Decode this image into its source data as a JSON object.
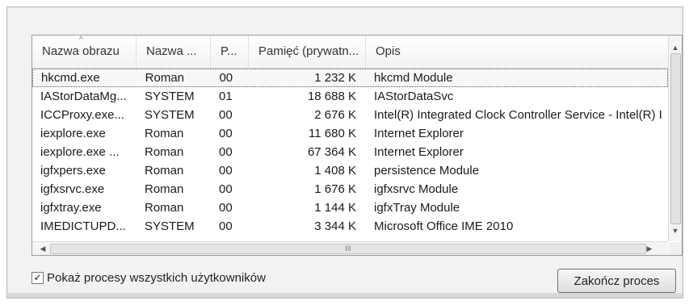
{
  "columns": [
    "Nazwa obrazu",
    "Nazwa ...",
    "P...",
    "Pamięć (prywatn...",
    "Opis"
  ],
  "rows": [
    {
      "name": "hkcmd.exe",
      "user": "Roman",
      "cpu": "00",
      "mem": "1 232 K",
      "desc": "hkcmd Module",
      "selected": true
    },
    {
      "name": "IAStorDataMg...",
      "user": "SYSTEM",
      "cpu": "01",
      "mem": "18 688 K",
      "desc": "IAStorDataSvc"
    },
    {
      "name": "ICCProxy.exe...",
      "user": "SYSTEM",
      "cpu": "00",
      "mem": "2 676 K",
      "desc": "Intel(R) Integrated Clock Controller Service - Intel(R) I"
    },
    {
      "name": "iexplore.exe",
      "user": "Roman",
      "cpu": "00",
      "mem": "11 680 K",
      "desc": "Internet Explorer"
    },
    {
      "name": "iexplore.exe ...",
      "user": "Roman",
      "cpu": "00",
      "mem": "67 364 K",
      "desc": "Internet Explorer"
    },
    {
      "name": "igfxpers.exe",
      "user": "Roman",
      "cpu": "00",
      "mem": "1 408 K",
      "desc": "persistence Module"
    },
    {
      "name": "igfxsrvc.exe",
      "user": "Roman",
      "cpu": "00",
      "mem": "1 676 K",
      "desc": "igfxsrvc Module"
    },
    {
      "name": "igfxtray.exe",
      "user": "Roman",
      "cpu": "00",
      "mem": "1 144 K",
      "desc": "igfxTray Module"
    },
    {
      "name": "IMEDICTUPD...",
      "user": "SYSTEM",
      "cpu": "00",
      "mem": "3 344 K",
      "desc": "Microsoft Office IME 2010"
    }
  ],
  "show_all_label": "Pokaż procesy wszystkich użytkowników",
  "show_all_checked": true,
  "end_process_label": "Zakończ proces",
  "hscroll_grip": "III"
}
